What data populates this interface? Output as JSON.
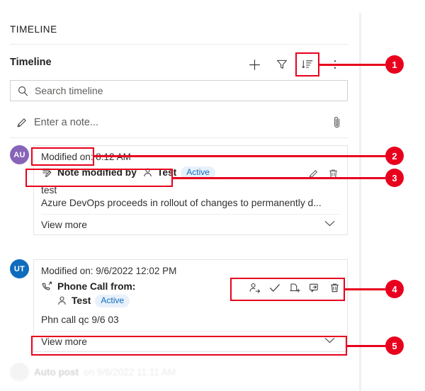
{
  "panel": {
    "section_title": "TIMELINE",
    "toolbar": {
      "title": "Timeline",
      "add_label": "+",
      "icons": {
        "add": "plus-icon",
        "filter": "funnel-filter-icon",
        "sort": "sort-order-icon",
        "more": "more-vertical-icon"
      }
    },
    "search": {
      "placeholder": "Search timeline",
      "icon": "search-icon"
    },
    "note": {
      "placeholder": "Enter a note...",
      "pencil_icon": "pencil-icon",
      "attach_icon": "paperclip-icon"
    }
  },
  "records": [
    {
      "avatar_initials": "AU",
      "avatar_color": "#8764B8",
      "modified_on": "Modified on: 8:12 AM",
      "subject_icon": "note-icon",
      "subject": "Note modified by",
      "person_icon": "person-icon",
      "person": "Test",
      "status": "Active",
      "body_lines": [
        "test",
        "Azure DevOps proceeds in rollout of changes to permanently d..."
      ],
      "view_more": "View more",
      "chevron_icon": "chevron-down-icon",
      "actions": [
        {
          "name": "edit-record-icon"
        },
        {
          "name": "delete-record-icon"
        }
      ]
    },
    {
      "avatar_initials": "UT",
      "avatar_color": "#0F6CBD",
      "modified_on": "Modified on: 9/6/2022 12:02 PM",
      "subject_icon": "phone-call-icon",
      "subject": "Phone Call from:",
      "person_icon": "person-icon",
      "person": "Test",
      "status": "Active",
      "body_lines": [
        "Phn call qc 9/6 03"
      ],
      "view_more": "View more",
      "chevron_icon": "chevron-down-icon",
      "actions": [
        {
          "name": "assign-icon"
        },
        {
          "name": "mark-complete-icon"
        },
        {
          "name": "add-to-queue-icon"
        },
        {
          "name": "convert-to-icon"
        },
        {
          "name": "delete-record-icon"
        }
      ]
    }
  ],
  "partial_record": {
    "text": "Auto post",
    "secondary": "on 9/6/2022 11:11 AM"
  },
  "annotations": {
    "accent_color": "#e8001d",
    "callouts": [
      {
        "number": "1",
        "target": "sort-order-toolbar-button"
      },
      {
        "number": "2",
        "target": "record-1-modified-on"
      },
      {
        "number": "3",
        "target": "record-1-subject-line"
      },
      {
        "number": "4",
        "target": "record-2-action-icons"
      },
      {
        "number": "5",
        "target": "record-2-view-more"
      }
    ]
  }
}
